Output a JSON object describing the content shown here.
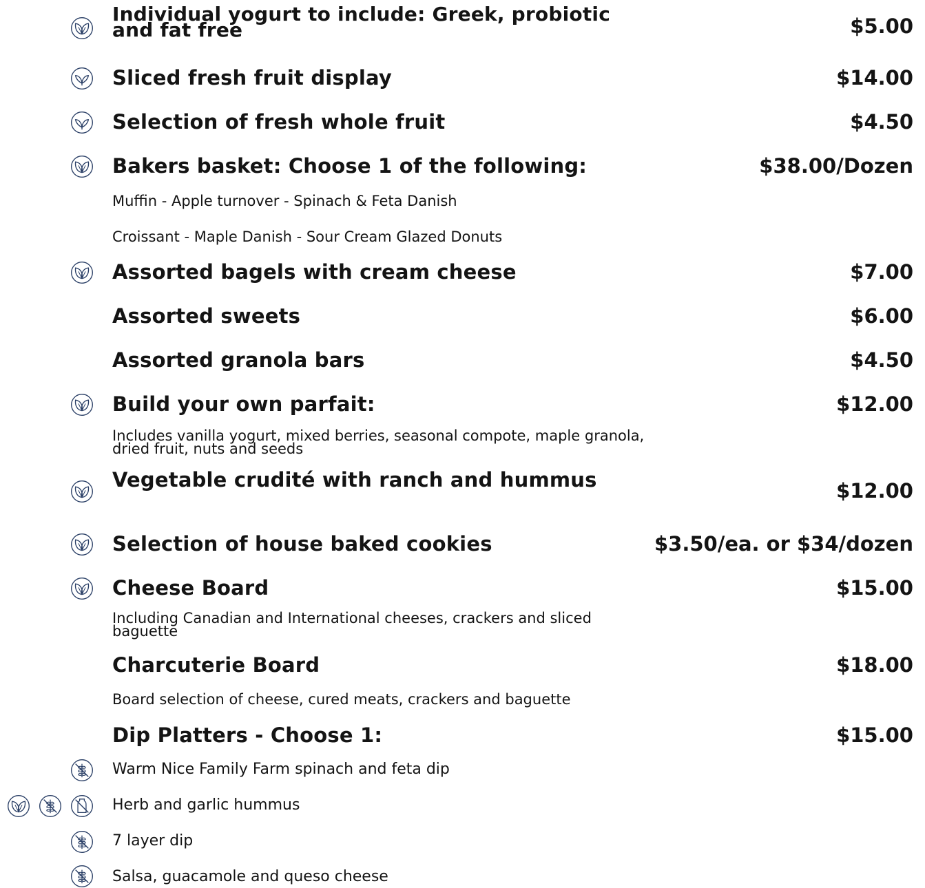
{
  "menu_items": [
    {
      "name": "Individual yogurt to include: Greek, probiotic and fat free",
      "price": "$5.00",
      "icon": "vegetarian-leaf-icon"
    },
    {
      "name": "Sliced fresh fruit display",
      "price": "$14.00",
      "icon": "vegan-sprout-icon"
    },
    {
      "name": "Selection of fresh whole fruit",
      "price": "$4.50",
      "icon": "vegan-sprout-icon"
    },
    {
      "name": "Bakers basket: Choose 1 of the following:",
      "price": "$38.00/Dozen",
      "icon": "vegetarian-leaf-icon",
      "options": [
        "Muffin - Apple turnover - Spinach & Feta Danish",
        "Croissant - Maple Danish - Sour Cream Glazed Donuts"
      ]
    },
    {
      "name": "Assorted bagels with cream cheese",
      "price": "$7.00",
      "icon": "vegetarian-leaf-icon"
    },
    {
      "name": "Assorted sweets",
      "price": "$6.00"
    },
    {
      "name": "Assorted granola bars",
      "price": "$4.50"
    },
    {
      "name": "Build your own parfait:",
      "price": "$12.00",
      "icon": "vegetarian-leaf-icon",
      "description": "Includes vanilla yogurt, mixed berries, seasonal compote, maple granola, dried fruit, nuts and seeds"
    },
    {
      "name": "Vegetable crudité with ranch and hummus",
      "price": "$12.00",
      "icon": "vegetarian-leaf-icon"
    },
    {
      "name": "Selection of house baked cookies",
      "price": "$3.50/ea. or $34/dozen",
      "icon": "vegetarian-leaf-icon"
    },
    {
      "name": "Cheese Board",
      "price": "$15.00",
      "icon": "vegetarian-leaf-icon",
      "description": "Including Canadian and International cheeses, crackers and sliced baguette"
    },
    {
      "name": "Charcuterie Board",
      "price": "$18.00",
      "description": "Board selection of cheese, cured meats, crackers and baguette"
    },
    {
      "name": "Dip Platters - Choose 1:",
      "price": "$15.00",
      "options": [
        {
          "label": "Warm Nice Family Farm spinach and feta dip",
          "icons": [
            "gluten-free-icon"
          ]
        },
        {
          "label": "Herb and garlic hummus",
          "icons": [
            "vegetarian-leaf-icon",
            "gluten-free-icon",
            "dairy-free-icon"
          ]
        },
        {
          "label": "7 layer dip",
          "icons": [
            "gluten-free-icon"
          ]
        },
        {
          "label": "Salsa, guacamole and queso cheese",
          "icons": [
            "gluten-free-icon"
          ]
        }
      ]
    }
  ],
  "colors": {
    "icon": "#2a3f66",
    "text": "#141414"
  }
}
